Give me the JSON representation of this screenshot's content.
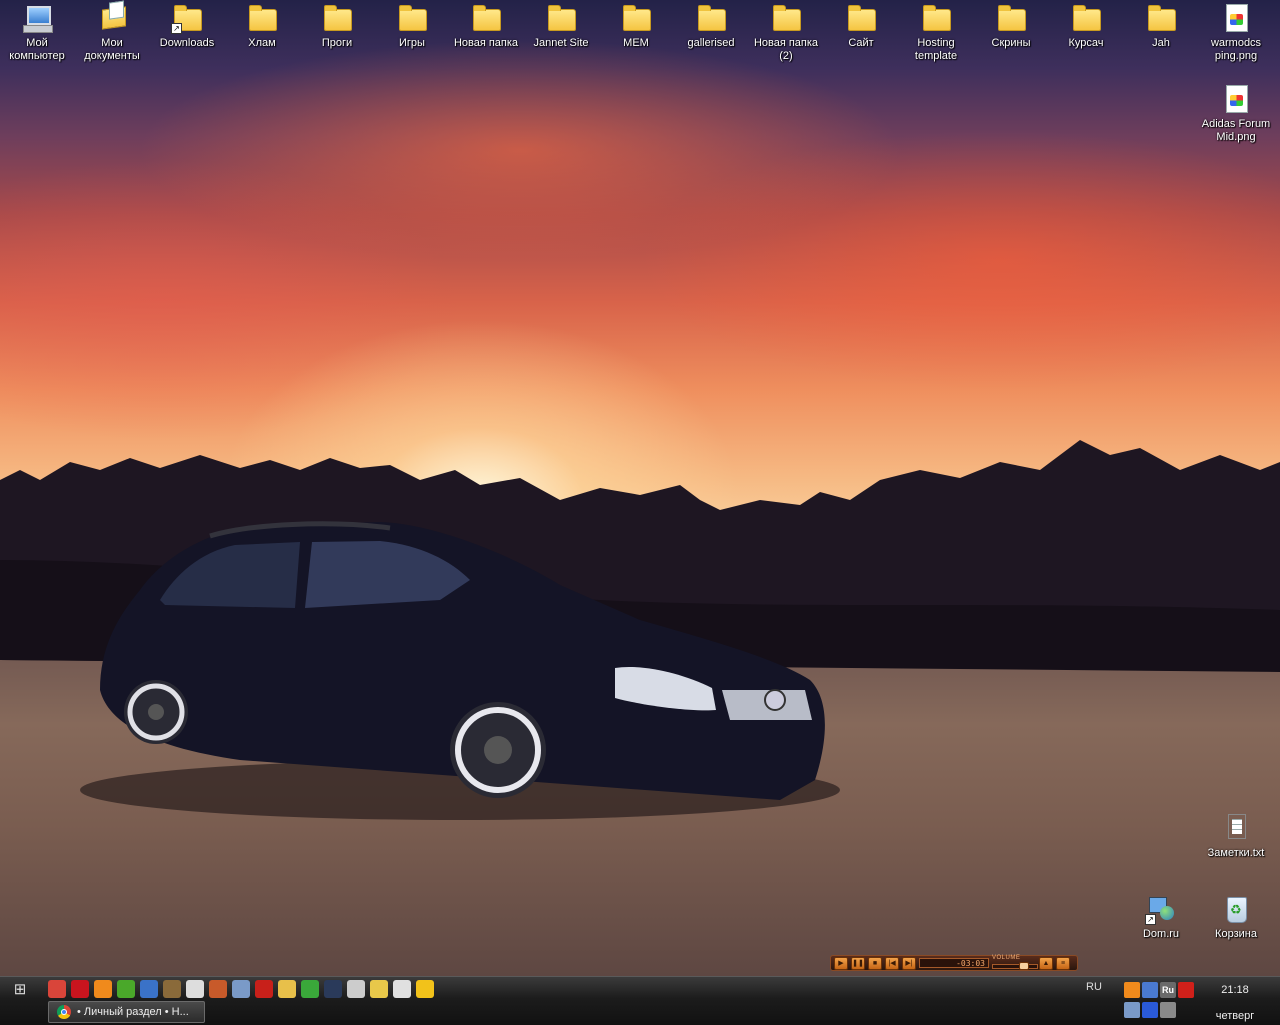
{
  "desktop": {
    "icons": [
      {
        "label": "Мой\nкомпьютер",
        "icon": "my-computer-icon"
      },
      {
        "label": "Мои\nдокументы",
        "icon": "my-documents-icon"
      },
      {
        "label": "Downloads",
        "icon": "folder-shortcut-icon"
      },
      {
        "label": "Хлам",
        "icon": "folder-icon"
      },
      {
        "label": "Проги",
        "icon": "folder-icon"
      },
      {
        "label": "Игры",
        "icon": "folder-icon"
      },
      {
        "label": "Новая папка",
        "icon": "folder-icon"
      },
      {
        "label": "Jannet Site",
        "icon": "folder-icon"
      },
      {
        "label": "МЕМ",
        "icon": "folder-icon"
      },
      {
        "label": "gallerised",
        "icon": "folder-icon"
      },
      {
        "label": "Новая папка\n(2)",
        "icon": "folder-icon"
      },
      {
        "label": "Сайт",
        "icon": "folder-icon"
      },
      {
        "label": "Hosting\ntemplate",
        "icon": "folder-icon"
      },
      {
        "label": "Скрины",
        "icon": "folder-icon"
      },
      {
        "label": "Курсач",
        "icon": "folder-icon"
      },
      {
        "label": "Jah",
        "icon": "folder-icon"
      },
      {
        "label": "warmodcs\nping.png",
        "icon": "image-file-icon"
      },
      {
        "label": "Adidas Forum\nMid.png",
        "icon": "image-file-icon"
      },
      {
        "label": "Заметки.txt",
        "icon": "text-file-icon"
      },
      {
        "label": "Dom.ru",
        "icon": "network-shortcut-icon"
      },
      {
        "label": "Корзина",
        "icon": "recycle-bin-icon"
      }
    ]
  },
  "player": {
    "time": "-03:03",
    "volume_label": "VOLUME",
    "volume_level": 0.75,
    "accent": "#e07a2a"
  },
  "taskbar": {
    "start_icon": "windows-logo-icon",
    "quick_launch": [
      {
        "name": "chrome-icon",
        "color": "#d9453a"
      },
      {
        "name": "opera-icon",
        "color": "#c8141e"
      },
      {
        "name": "avast-icon",
        "color": "#f08a1c"
      },
      {
        "name": "utorrent-icon",
        "color": "#4aa82a"
      },
      {
        "name": "messenger-icon",
        "color": "#3a72c8"
      },
      {
        "name": "paint-icon",
        "color": "#8a6a3a"
      },
      {
        "name": "skull-icon",
        "color": "#dddddd"
      },
      {
        "name": "browser-icon",
        "color": "#c85a2a"
      },
      {
        "name": "notepad-icon",
        "color": "#7a9ac8"
      },
      {
        "name": "filezilla-icon",
        "color": "#c8201a"
      },
      {
        "name": "mail-icon",
        "color": "#e8c04a"
      },
      {
        "name": "editor-icon",
        "color": "#3aa83a"
      },
      {
        "name": "winamp-icon",
        "color": "#2a3a5a"
      },
      {
        "name": "mouse-icon",
        "color": "#cccccc"
      },
      {
        "name": "character-icon",
        "color": "#e8c84a"
      },
      {
        "name": "alien-icon",
        "color": "#e0e0e0"
      },
      {
        "name": "aim-icon",
        "color": "#f2c21a"
      }
    ],
    "task_button_label": "• Личный раздел • Н...",
    "language": "RU",
    "tray_icons": [
      {
        "name": "media-tray-icon",
        "color": "#f08a1c"
      },
      {
        "name": "network-tray-icon",
        "color": "#4a7ad0"
      },
      {
        "name": "ru-tray-icon",
        "color": "#6a6a6a",
        "text": "Ru"
      },
      {
        "name": "opera-tray-icon",
        "color": "#d0201a"
      },
      {
        "name": "connection-tray-icon",
        "color": "#7a9ac8"
      },
      {
        "name": "play-tray-icon",
        "color": "#2a5ad8"
      },
      {
        "name": "settings-tray-icon",
        "color": "#8a8a8a"
      }
    ],
    "clock_time": "21:18",
    "clock_day": "четверг"
  }
}
